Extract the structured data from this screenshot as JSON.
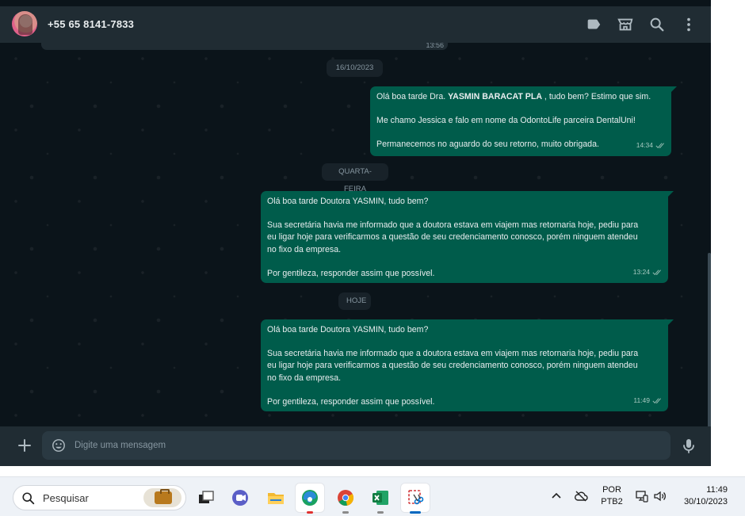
{
  "header": {
    "contact_name": "+55 65 8141-7833",
    "icons": [
      "label-icon",
      "catalog-icon",
      "search-icon",
      "menu-icon"
    ]
  },
  "chat": {
    "prev_message_time": "13:56",
    "date_chips": [
      "16/10/2023",
      "QUARTA-FEIRA",
      "HOJE"
    ],
    "messages": [
      {
        "lines": [
          {
            "before": "Olá boa tarde Dra. ",
            "bold": "YASMIN BARACAT PLA",
            "after": " , tudo bem? Estimo que sim."
          },
          "",
          "Me chamo Jessica e falo em nome da OdontoLife parceira DentalUni!",
          "",
          "Permanecemos no aguardo do seu retorno, muito obrigada."
        ],
        "time": "14:34",
        "status": "read"
      },
      {
        "lines": [
          "Olá boa tarde Doutora YASMIN, tudo bem?",
          "",
          "Sua secretária havia me informado que a doutora estava em viajem mas retornaria hoje, pediu para",
          "eu ligar hoje para verificarmos a questão de seu credenciamento conosco, porém ninguem atendeu",
          "no fixo da empresa.",
          "",
          "Por gentileza, responder assim que possível."
        ],
        "time": "13:24",
        "status": "read"
      },
      {
        "lines": [
          "Olá boa tarde Doutora YASMIN, tudo bem?",
          "",
          "Sua secretária havia me informado que a doutora estava em viajem mas retornaria hoje, pediu para",
          "eu ligar hoje para verificarmos a questão de seu credenciamento conosco, porém ninguem atendeu",
          "no fixo da empresa.",
          "",
          "Por gentileza, responder assim que possível."
        ],
        "time": "11:49",
        "status": "read"
      }
    ]
  },
  "compose": {
    "placeholder": "Digite uma mensagem",
    "value": ""
  },
  "taskbar": {
    "search_label": "Pesquisar",
    "apps": [
      "task-view",
      "teams",
      "file-explorer",
      "edge",
      "chrome",
      "excel",
      "snipping-tool"
    ],
    "language_line1": "POR",
    "language_line2": "PTB2",
    "time": "11:49",
    "date": "30/10/2023"
  },
  "colors": {
    "header_bg": "#202c33",
    "chat_bg": "#0b141a",
    "outgoing_bubble": "#005c4b",
    "date_chip_bg": "#182229",
    "taskbar_bg": "#eef2f7"
  }
}
